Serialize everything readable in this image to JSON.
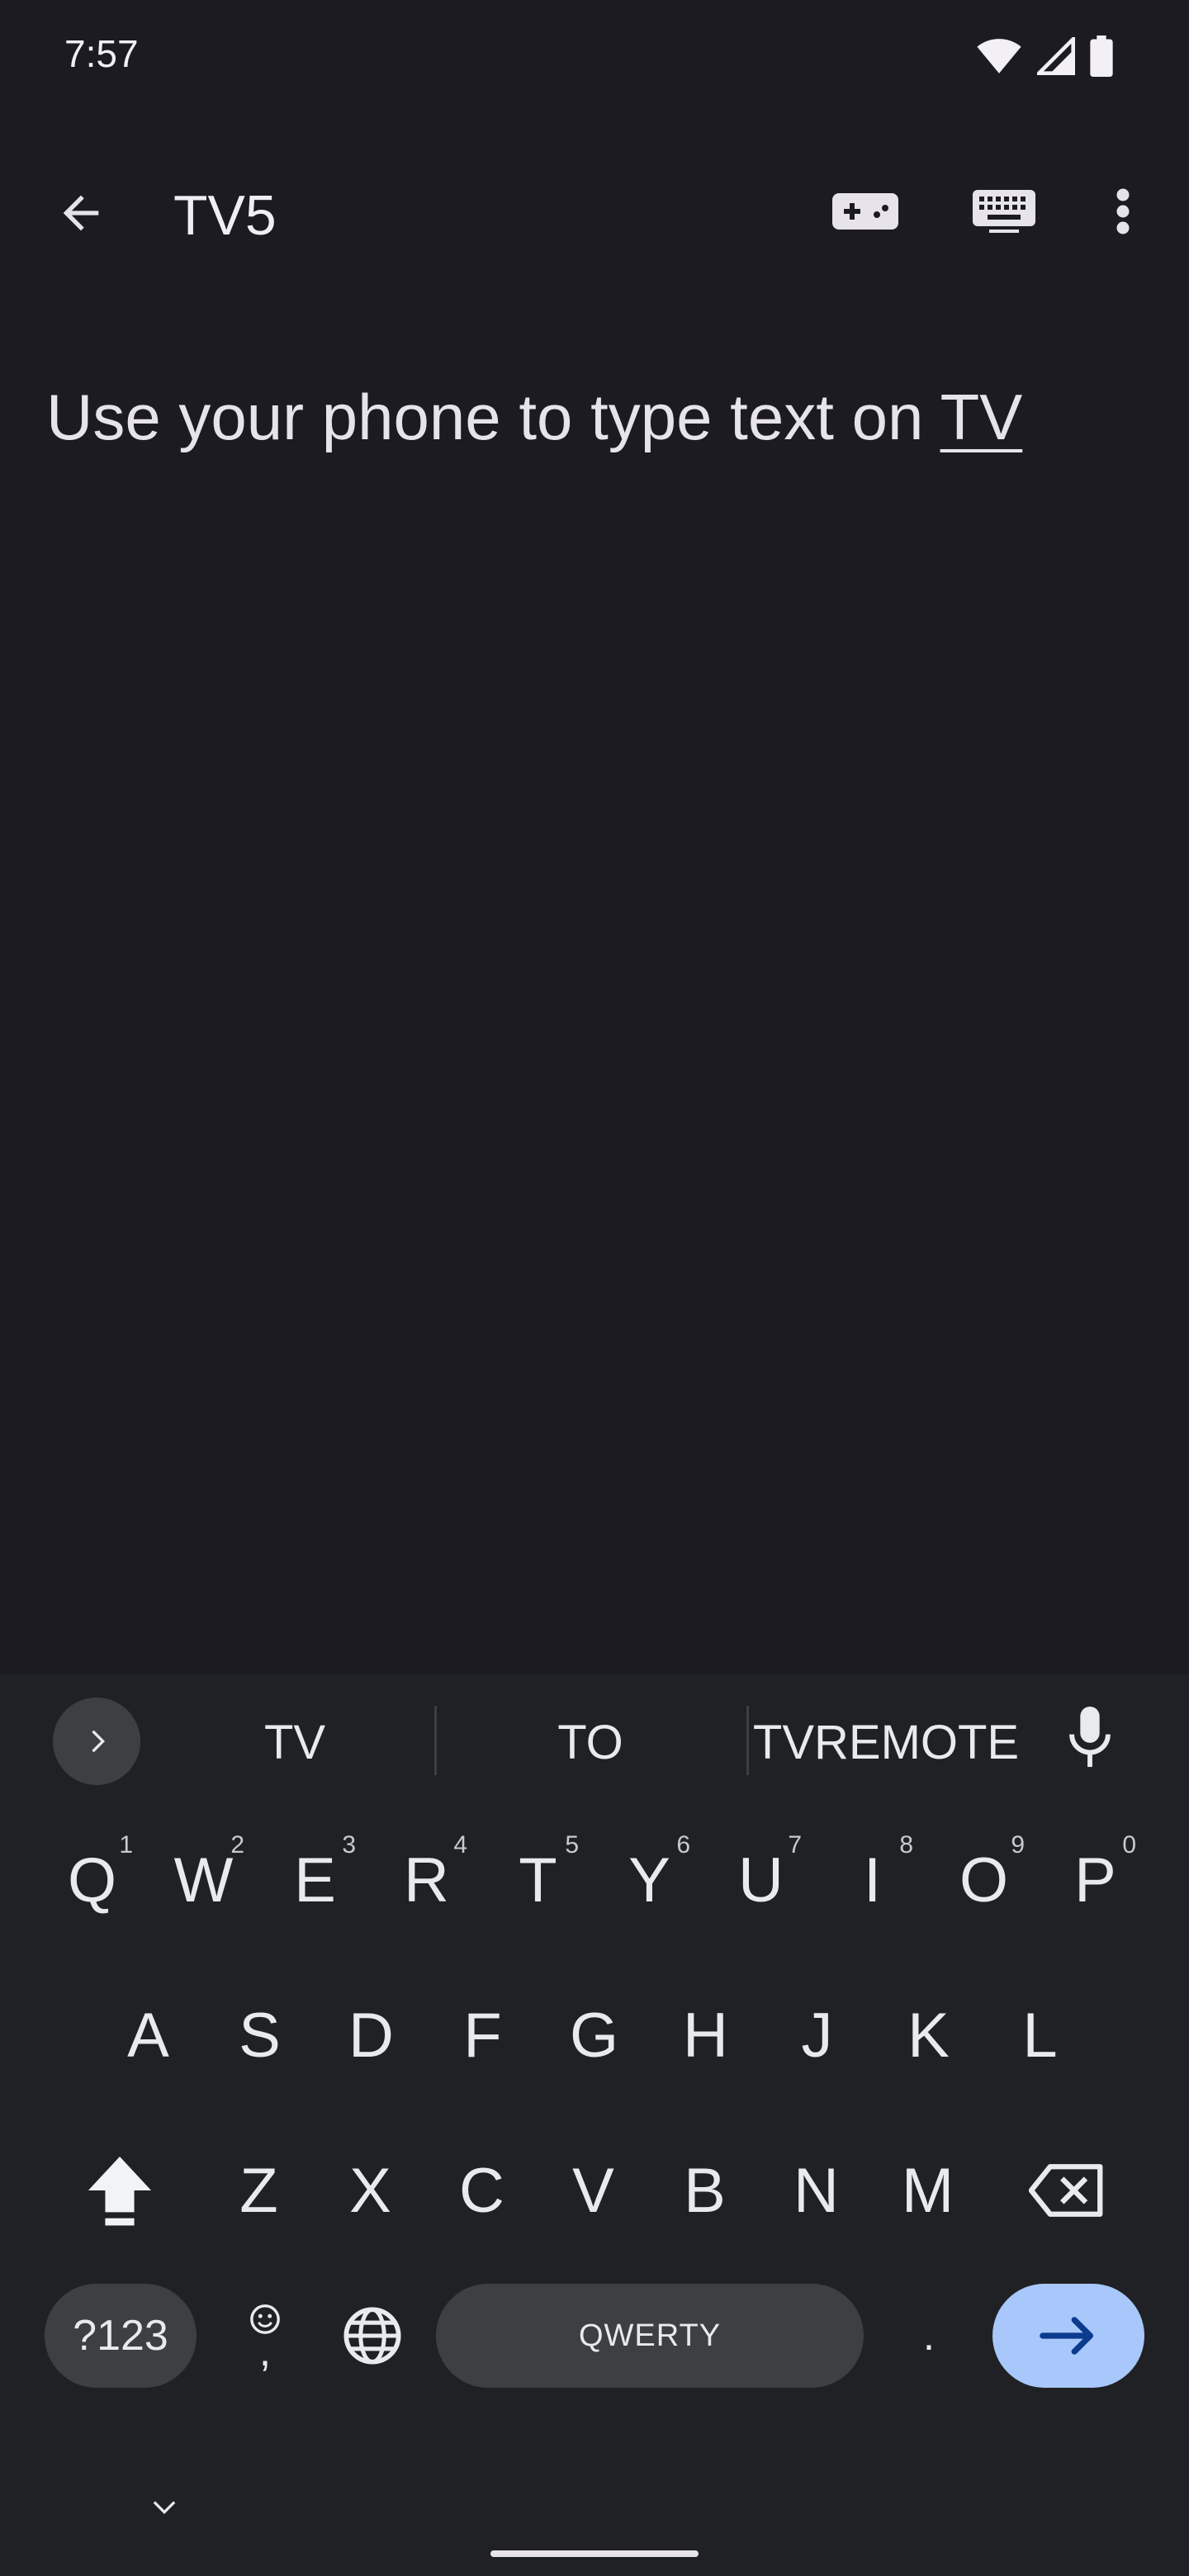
{
  "status": {
    "time": "7:57",
    "icons": [
      "wifi-icon",
      "signal-icon",
      "battery-icon"
    ]
  },
  "appbar": {
    "title": "TV5",
    "actions": [
      "back-arrow-icon",
      "gamepad-icon",
      "keyboard-icon",
      "more-vert-icon"
    ]
  },
  "content": {
    "text_prefix": "Use your phone to type text on ",
    "text_last_word": "TV"
  },
  "keyboard": {
    "suggestions": [
      "TV",
      "TO",
      "TVREMOTE"
    ],
    "row1": [
      {
        "k": "Q",
        "h": "1"
      },
      {
        "k": "W",
        "h": "2"
      },
      {
        "k": "E",
        "h": "3"
      },
      {
        "k": "R",
        "h": "4"
      },
      {
        "k": "T",
        "h": "5"
      },
      {
        "k": "Y",
        "h": "6"
      },
      {
        "k": "U",
        "h": "7"
      },
      {
        "k": "I",
        "h": "8"
      },
      {
        "k": "O",
        "h": "9"
      },
      {
        "k": "P",
        "h": "0"
      }
    ],
    "row2": [
      "A",
      "S",
      "D",
      "F",
      "G",
      "H",
      "J",
      "K",
      "L"
    ],
    "row3": [
      "Z",
      "X",
      "C",
      "V",
      "B",
      "N",
      "M"
    ],
    "symbols_label": "?123",
    "space_label": "QWERTY",
    "period_label": ".",
    "emoji_comma_label": ",",
    "accent_color": "#a8c7fa",
    "enter_icon_color": "#0b3a8e"
  }
}
